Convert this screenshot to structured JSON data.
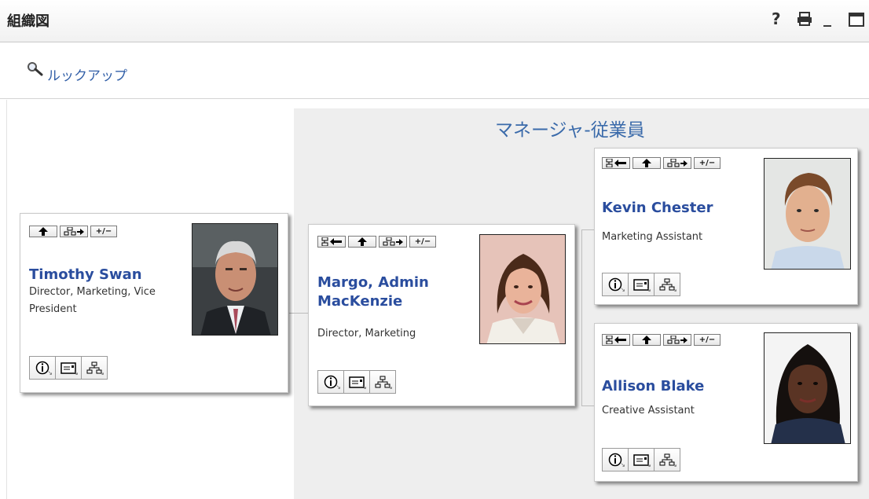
{
  "window": {
    "title": "組織図",
    "controls": {
      "help": "?",
      "print_icon": "printer-icon",
      "minimize": "_",
      "maximize_icon": "maximize-icon"
    }
  },
  "lookup": {
    "icon": "magnifier-icon",
    "label": "ルックアップ"
  },
  "group": {
    "title": "マネージャ-従業員"
  },
  "toolbar_icons": [
    "go-to-manager-icon",
    "up-arrow-icon",
    "expand-subordinates-icon",
    "expand-collapse-icon"
  ],
  "toolbar_labels": {
    "expand_collapse": "+/−"
  },
  "action_icons": [
    "info-icon",
    "email-icon",
    "org-chart-icon"
  ],
  "people": {
    "root": {
      "name": "Timothy Swan",
      "title": "Director, Marketing, Vice President"
    },
    "manager": {
      "name": "Margo, Admin MacKenzie",
      "title": "Director, Marketing"
    },
    "reports": [
      {
        "name": "Kevin Chester",
        "title": "Marketing Assistant"
      },
      {
        "name": "Allison Blake",
        "title": "Creative Assistant"
      }
    ]
  },
  "colors": {
    "link": "#2a4d9e",
    "group_title": "#3a6aaa",
    "shaded_panel": "#eeeeee"
  }
}
